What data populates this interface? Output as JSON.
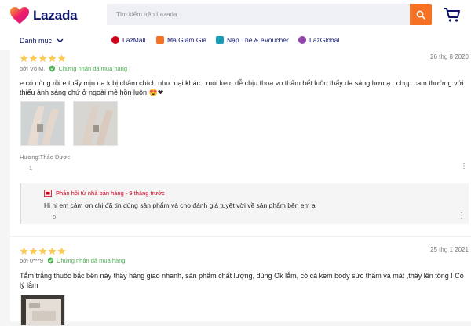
{
  "header": {
    "logo_text": "Lazada",
    "search_placeholder": "Tìm kiếm trên Lazada",
    "brand_color": "#0f146d",
    "accent_color": "#f57224"
  },
  "nav": {
    "category_label": "Danh mục",
    "items": [
      {
        "label": "LazMall",
        "icon": "lazmall-icon",
        "color": "#d0011b"
      },
      {
        "label": "Mã Giảm Giá",
        "icon": "voucher-icon",
        "color": "#f57224"
      },
      {
        "label": "Nạp Thẻ & eVoucher",
        "icon": "topup-icon",
        "color": "#1a9cb7"
      },
      {
        "label": "LazGlobal",
        "icon": "lazglobal-icon",
        "color": "#8e44ad"
      }
    ]
  },
  "reviews": [
    {
      "rating": 5,
      "date": "26 thg 8 2020",
      "author": "bởi Võ M.",
      "verified": "Chứng nhận đã mua hàng",
      "content": "e có dùng rồi e thấy mịn da k bị châm chích như loại khác...mùi kem dễ chịu thoa vo thấm hết luôn thấy da sáng hơn ạ...chụp cam thường với thiếu ánh sáng chứ ở ngoài mê hồn luôn 😍❤",
      "sku": "Hương:Thảo Dược",
      "likes": "1",
      "seller_reply": {
        "title": "Phản hồi từ nhà bán hàng - 9 tháng trước",
        "text": "Hi hi em cảm ơn chị đã tin dùng sản phẩm và cho đánh giá tuyệt vời về sản phẩm bên em ạ",
        "likes": "0"
      }
    },
    {
      "rating": 5,
      "date": "25 thg 1 2021",
      "author": "bởi 0***9",
      "verified": "Chứng nhận đã mua hàng",
      "content": "Tắm trắng thuốc bắc bên này thấy hàng giao nhanh, sản phẩm chất lượng, dùng Ok lắm, có cả kem body sức thấm và mát ,thấy lên tông ! Có lý lắm"
    }
  ]
}
